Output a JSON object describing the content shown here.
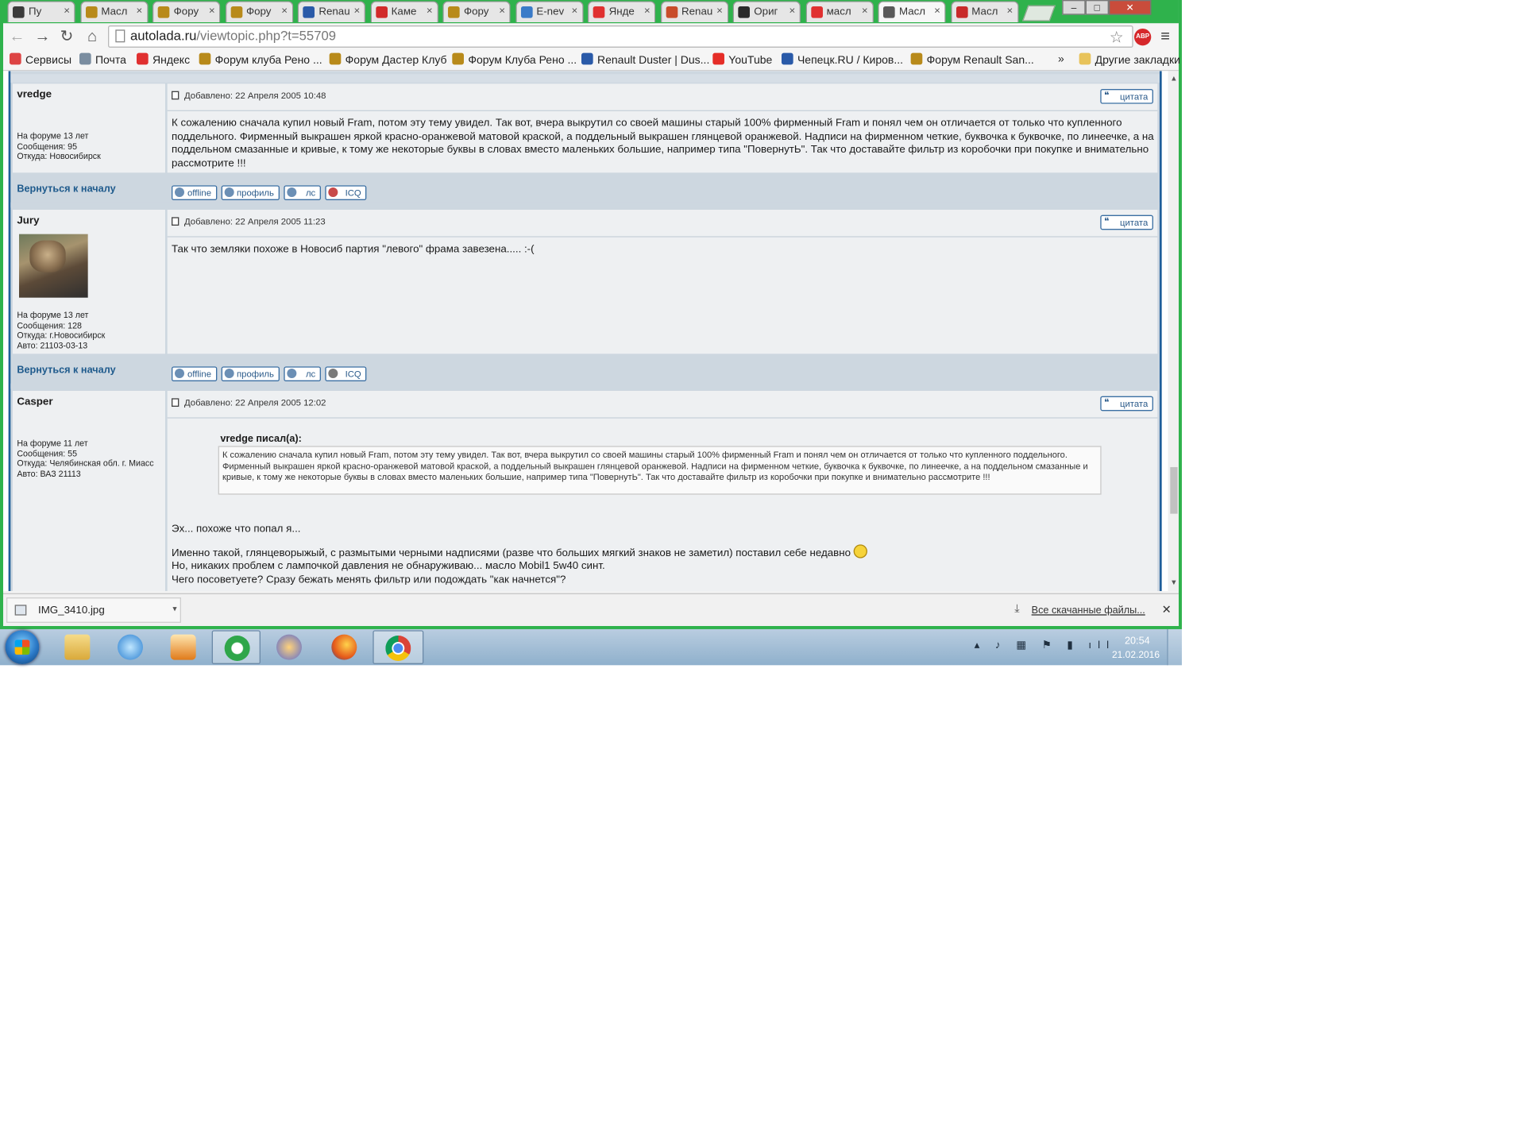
{
  "browser": {
    "tabs": [
      {
        "label": "Пу",
        "fav": "#3a3a3a"
      },
      {
        "label": "Масл",
        "fav": "#b88a1a"
      },
      {
        "label": "Фору",
        "fav": "#b88a1a"
      },
      {
        "label": "Фору",
        "fav": "#b88a1a"
      },
      {
        "label": "Renau",
        "fav": "#2a5aa8"
      },
      {
        "label": "Каме",
        "fav": "#d12a2a"
      },
      {
        "label": "Фору",
        "fav": "#b88a1a"
      },
      {
        "label": "E-nev",
        "fav": "#3a7bc8"
      },
      {
        "label": "Янде",
        "fav": "#e03030"
      },
      {
        "label": "Renau",
        "fav": "#c84c2a"
      },
      {
        "label": "Ориг",
        "fav": "#2a2a2a"
      },
      {
        "label": "масл",
        "fav": "#e03030"
      },
      {
        "label": "Масл",
        "fav": "#5a5a5a"
      },
      {
        "label": "Масл",
        "fav": "#c82a2a"
      }
    ],
    "active_tab_index": 12,
    "tab_close_glyph": "×",
    "url_host": "autolada.ru",
    "url_path": "/viewtopic.php?t=55709",
    "abp_label": "ABP",
    "bookmarks": [
      {
        "label": "Сервисы",
        "color": "#d44"
      },
      {
        "label": "Почта",
        "color": "#7a8da0"
      },
      {
        "label": "Яндекс",
        "color": "#e03030"
      },
      {
        "label": "Форум клуба Рено ...",
        "color": "#b88a1a"
      },
      {
        "label": "Форум Дастер Клуб",
        "color": "#b88a1a"
      },
      {
        "label": "Форум Клуба Рено ...",
        "color": "#b88a1a"
      },
      {
        "label": "Renault Duster | Dus...",
        "color": "#2a5aa8"
      },
      {
        "label": "YouTube",
        "color": "#e52d27"
      },
      {
        "label": "Чепецк.RU / Киров...",
        "color": "#2a5aa8"
      },
      {
        "label": "Форум Renault San...",
        "color": "#b88a1a"
      }
    ],
    "bookmarks_more": "»",
    "other_bookmarks": "Другие закладки"
  },
  "posts": [
    {
      "author": "vredge",
      "info": "На форуме 13 лет\nСообщения: 95\nОткуда: Новосибирск",
      "date": "Добавлено: 22 Апреля 2005 10:48",
      "quote_label": "цитата",
      "body": "К сожалению сначала купил новый Fram, потом эту тему увидел. Так вот, вчера выкрутил со своей машины старый 100% фирменный Fram и понял чем он отличается от только что купленного поддельного. Фирменный выкрашен яркой красно-оранжевой матовой краской, а поддельный выкрашен глянцевой оранжевой. Надписи на фирменном четкие, буквочка к буквочке, по линеечке, а на поддельном смазанные и кривые, к тому же некоторые буквы в словах вместо маленьких большие, например типа \"ПовернутЬ\". Так что доставайте фильтр из коробочки при покупке и внимательно рассмотрите !!!"
    },
    {
      "author": "Jury",
      "info": "На форуме 13 лет\nСообщения: 128\nОткуда: г.Новосибирск\nАвто: 21103-03-13",
      "date": "Добавлено: 22 Апреля 2005 11:23",
      "quote_label": "цитата",
      "body": "Так что земляки похоже в Новосиб партия \"левого\" фрама завезена..... :-("
    },
    {
      "author": "Casper",
      "info": "На форуме 11 лет\nСообщения: 55\nОткуда: Челябинская обл. г. Миасс\nАвто: ВАЗ 21113",
      "date": "Добавлено: 22 Апреля 2005 12:02",
      "quote_label": "цитата",
      "quote_title": "vredge писал(а):",
      "quote_text": "К сожалению сначала купил новый Fram, потом эту тему увидел. Так вот, вчера выкрутил со своей машины старый 100% фирменный Fram и понял чем он отличается от только что купленного поддельного. Фирменный выкрашен яркой красно-оранжевой матовой краской, а поддельный выкрашен глянцевой оранжевой. Надписи на фирменном четкие, буквочка к буквочке, по линеечке, а на поддельном смазанные и кривые, к тому же некоторые буквы в словах вместо маленьких большие, например типа \"ПовернутЬ\". Так что доставайте фильтр из коробочки при покупке и внимательно рассмотрите !!!",
      "body1": "Эх... похоже что попал я...",
      "body2": "Именно такой, глянцеворыжый, с размытыми черными надписями (разве что больших мягкий знаков не заметил) поставил себе недавно",
      "body3": "Но, никаких проблем с лампочкой давления не обнаруживаю... масло Mobil1 5w40 синт.\nЧего посоветуете? Сразу бежать менять фильтр или подождать \"как начнется\"?"
    }
  ],
  "post_buttons": {
    "back_to_top": "Вернуться к началу",
    "offline": "offline",
    "profile": "профиль",
    "pm": "лс",
    "icq": "ICQ"
  },
  "download": {
    "file": "IMG_3410.jpg",
    "all_downloads": "Все скачанные файлы..."
  },
  "taskbar": {
    "time": "20:54",
    "date": "21.02.2016"
  }
}
